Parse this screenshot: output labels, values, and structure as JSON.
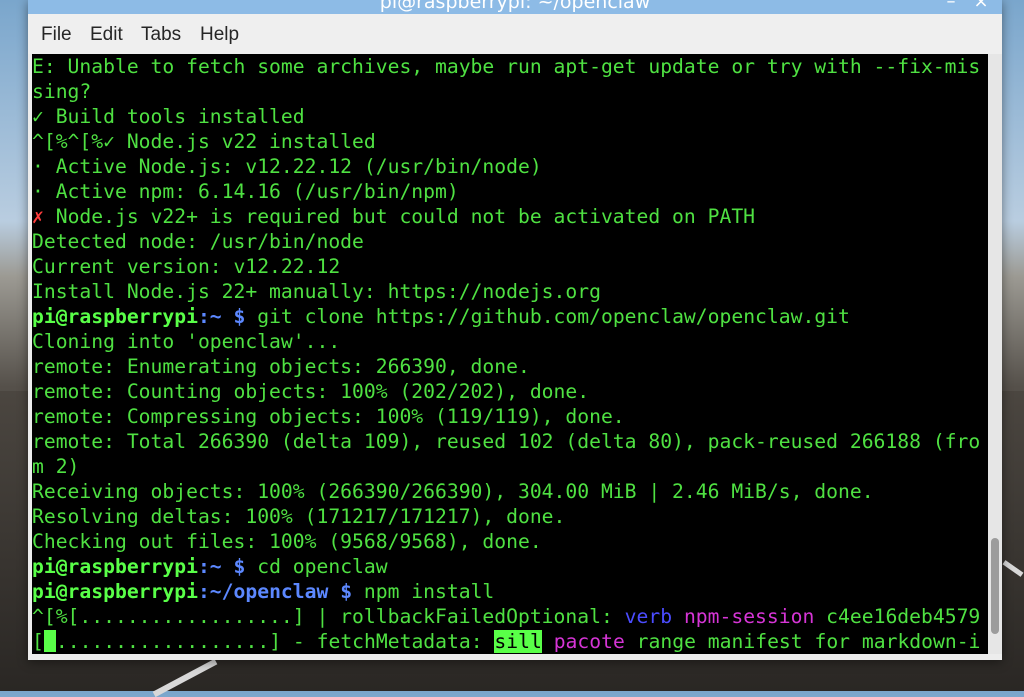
{
  "window": {
    "title": "pi@raspberrypi: ~/openclaw",
    "minimize_icon": "minimize-icon",
    "close_icon": "close-icon"
  },
  "menu": [
    "File",
    "Edit",
    "Tabs",
    "Help"
  ],
  "terminal": {
    "lines": {
      "l1": "E: Unable to fetch some archives, maybe run apt-get update or try with --fix-mis",
      "l2": "sing?",
      "l3": "✓ Build tools installed",
      "l4": "^[%^[%✓ Node.js v22 installed",
      "l5": "· Active Node.js: v12.22.12 (/usr/bin/node)",
      "l6": "· Active npm: 6.14.16 (/usr/bin/npm)",
      "l7_mark": "✗",
      "l7": " Node.js v22+ is required but could not be activated on PATH",
      "l8": "Detected node: /usr/bin/node",
      "l9": "Current version: v12.22.12",
      "l10": "Install Node.js 22+ manually: https://nodejs.org",
      "l11_user": "pi@raspberrypi",
      "l11_path": ":~ $",
      "l11_cmd": " git clone https://github.com/openclaw/openclaw.git",
      "l12": "Cloning into 'openclaw'...",
      "l13": "remote: Enumerating objects: 266390, done.",
      "l14": "remote: Counting objects: 100% (202/202), done.",
      "l15": "remote: Compressing objects: 100% (119/119), done.",
      "l16": "remote: Total 266390 (delta 109), reused 102 (delta 80), pack-reused 266188 (fro",
      "l17": "m 2)",
      "l18": "Receiving objects: 100% (266390/266390), 304.00 MiB | 2.46 MiB/s, done.",
      "l19": "Resolving deltas: 100% (171217/171217), done.",
      "l20": "Checking out files: 100% (9568/9568), done.",
      "l21_user": "pi@raspberrypi",
      "l21_path": ":~ $",
      "l21_cmd": " cd openclaw",
      "l22_user": "pi@raspberrypi",
      "l22_path": ":~/openclaw $",
      "l22_cmd": " npm install",
      "l23_a": "^[%[..................] | rollbackFailedOptional: ",
      "l23_verb": "verb",
      "l23_b": " ",
      "l23_sess": "npm-session",
      "l23_c": " c4ee16deb4579",
      "l24_a": "[",
      "l24_b": "..................] - fetchMetadata: ",
      "l24_sill": "sill",
      "l24_c": " ",
      "l24_pacote": "pacote",
      "l24_d": " range manifest for markdown-i"
    }
  },
  "colors": {
    "terminal_bg": "#000000",
    "text_green": "#4fe142",
    "prompt_green": "#59ff48",
    "path_blue": "#5c88ff",
    "error_red": "#ff3d3d",
    "magenta": "#d635d6",
    "titlebar": "#8dbbe6"
  }
}
